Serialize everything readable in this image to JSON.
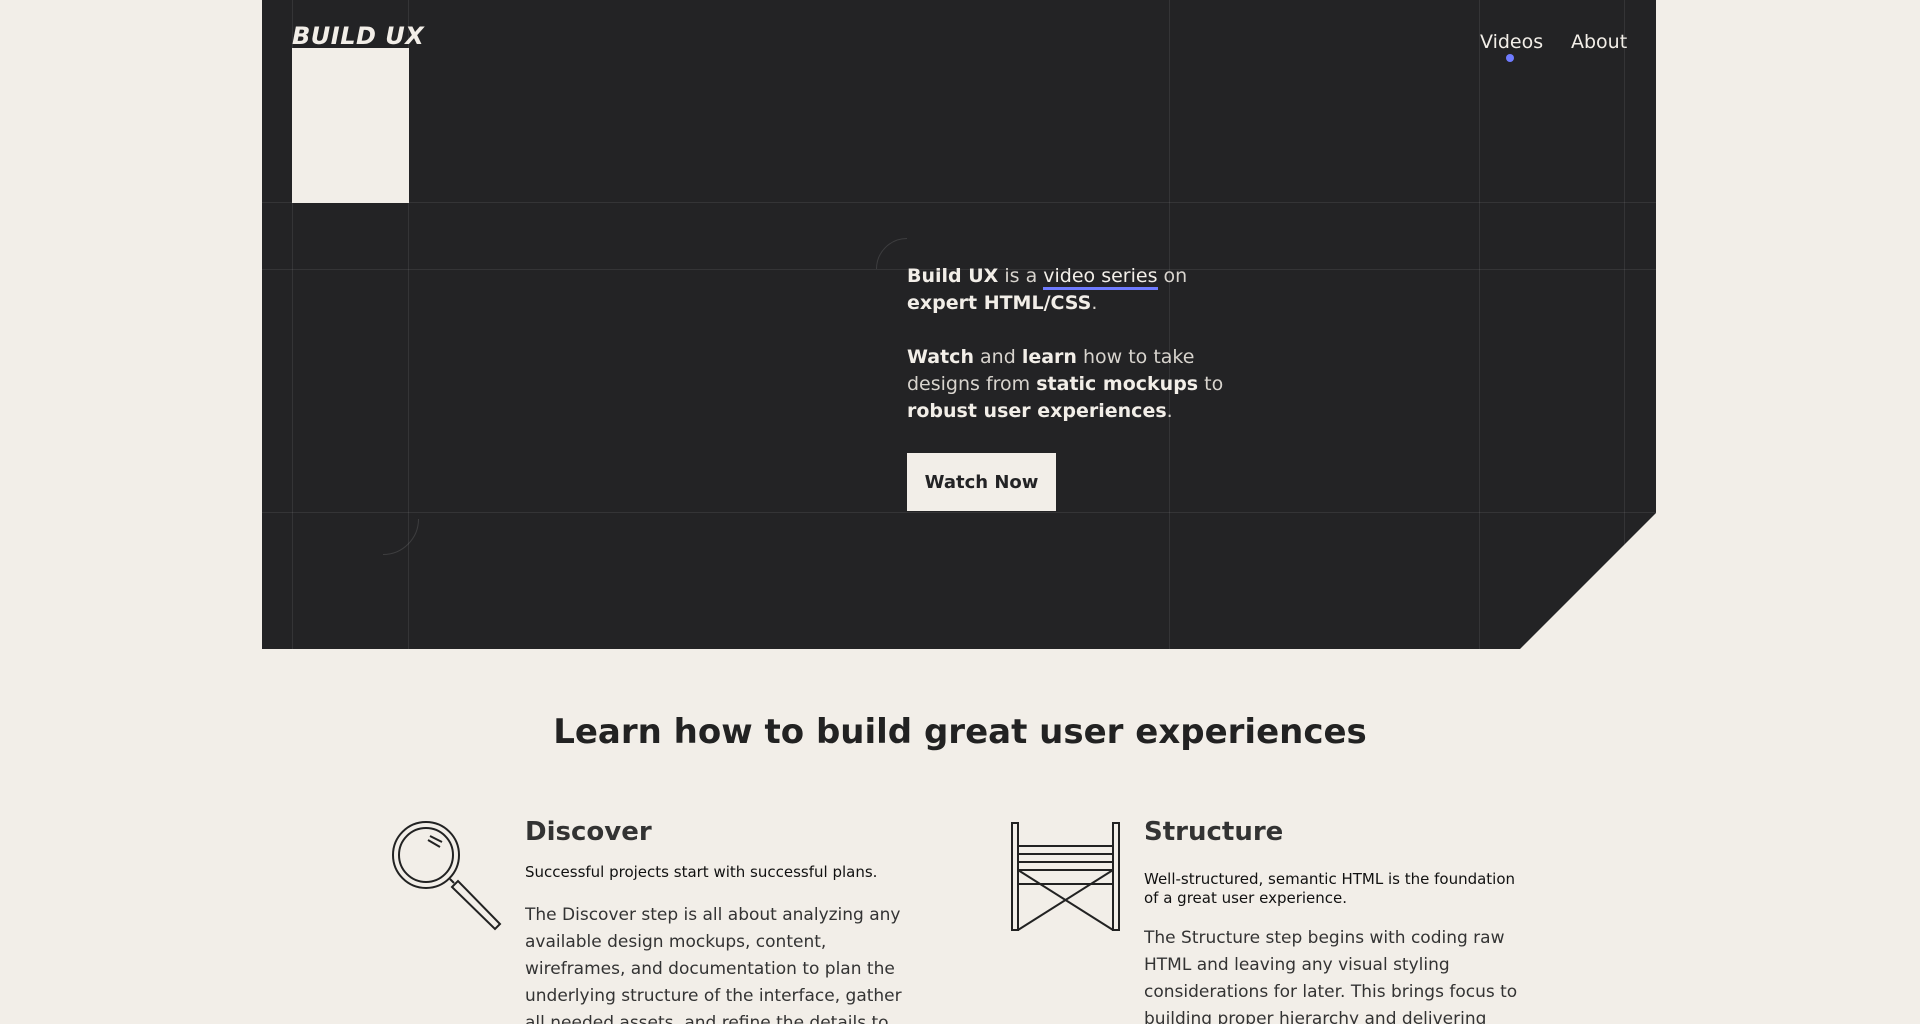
{
  "header": {
    "logo": "BUILD UX",
    "nav": [
      {
        "label": "Videos",
        "active": true
      },
      {
        "label": "About",
        "active": false
      }
    ],
    "accent": "#6f7bff"
  },
  "hero": {
    "p1": {
      "a": "Build UX",
      "b": " is a ",
      "link": "video series",
      "c": " on ",
      "d": "expert HTML/CSS",
      "e": "."
    },
    "p2": {
      "a": "Watch",
      "b": " and ",
      "c": "learn",
      "d": " how to take designs from ",
      "e": "static mockups",
      "f": " to ",
      "g": "robust user experiences",
      "h": "."
    },
    "cta": "Watch Now"
  },
  "section": {
    "title": "Learn how to build great user experiences",
    "features": [
      {
        "icon": "magnifying-glass-icon",
        "title": "Discover",
        "subtitle": "Successful projects start with successful plans.",
        "body": "The Discover step is all about analyzing any available design mockups, content, wireframes, and documentation to plan the underlying structure of the interface, gather all needed assets, and refine the details to ensure the user"
      },
      {
        "icon": "scaffolding-icon",
        "title": "Structure",
        "subtitle": "Well-structured, semantic HTML is the foundation of a great user experience.",
        "body": "The Structure step begins with coding raw HTML and leaving any visual styling considerations for later. This brings focus to building proper hierarchy and delivering content in the ideal"
      }
    ]
  },
  "colors": {
    "background": "#f2eee8",
    "dark": "#232325",
    "accent": "#6f7bff"
  }
}
